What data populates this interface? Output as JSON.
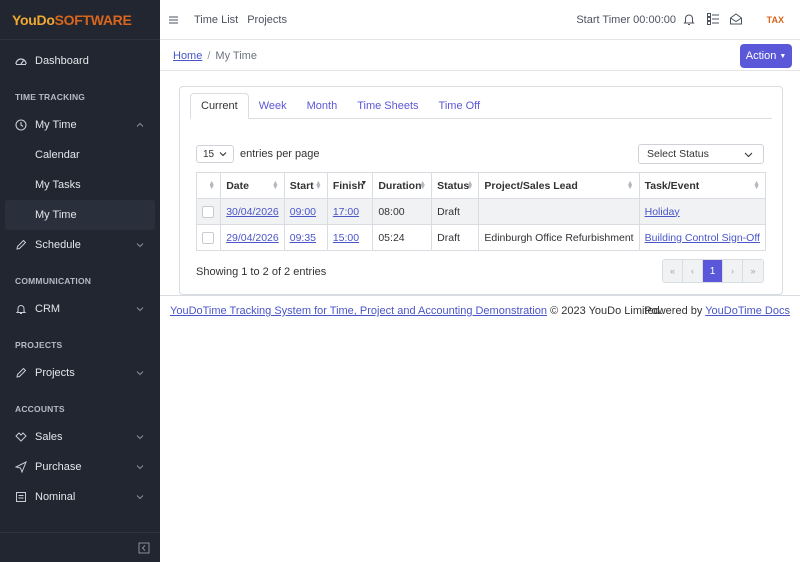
{
  "brand": {
    "part1": "YouDo",
    "part2": "SOFTWARE"
  },
  "sidebar": {
    "dashboard": "Dashboard",
    "section_time": "TIME TRACKING",
    "my_time": "My Time",
    "sub_items": [
      "Calendar",
      "My Tasks",
      "My Time"
    ],
    "schedule": "Schedule",
    "section_comm": "COMMUNICATION",
    "crm": "CRM",
    "section_projects": "PROJECTS",
    "projects": "Projects",
    "section_accounts": "ACCOUNTS",
    "sales": "Sales",
    "purchase": "Purchase",
    "nominal": "Nominal"
  },
  "header": {
    "links": [
      "Time List",
      "Projects"
    ],
    "timer": "Start Timer 00:00:00",
    "tax": "TAX"
  },
  "breadcrumb": {
    "home": "Home",
    "current": "My Time"
  },
  "action_label": "Action",
  "tabs": [
    "Current",
    "Week",
    "Month",
    "Time Sheets",
    "Time Off"
  ],
  "table_controls": {
    "page_length": "15",
    "page_length_label": "entries per page",
    "status_placeholder": "Select Status"
  },
  "table": {
    "headers": [
      "Date",
      "Start",
      "Finish",
      "Duration",
      "Status",
      "Project/Sales Lead",
      "Task/Event"
    ],
    "rows": [
      {
        "date": "30/04/2026",
        "start": "09:00",
        "finish": "17:00",
        "duration": "08:00",
        "status": "Draft",
        "project": "",
        "task": "Holiday"
      },
      {
        "date": "29/04/2026",
        "start": "09:35",
        "finish": "15:00",
        "duration": "05:24",
        "status": "Draft",
        "project": "Edinburgh Office Refurbishment",
        "task": "Building Control Sign-Off"
      }
    ]
  },
  "table_info": "Showing 1 to 2 of 2 entries",
  "pagination": {
    "first": "«",
    "prev": "‹",
    "current": "1",
    "next": "›",
    "last": "»"
  },
  "footer": {
    "link": "YouDoTime Tracking System for Time, Project and Accounting Demonstration",
    "copyright": "© 2023 YouDo Limited.",
    "powered_by": "Powered by",
    "docs_link": "YouDoTime Docs"
  },
  "colors": {
    "accent": "#5b57d9",
    "sidebar_bg": "#212631",
    "brand_orange": "#d8661c"
  }
}
